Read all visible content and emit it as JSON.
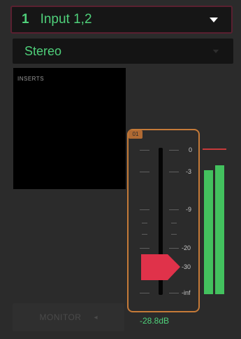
{
  "input": {
    "number": "1",
    "label": "Input 1,2"
  },
  "mode": {
    "label": "Stereo"
  },
  "inserts": {
    "label": "INSERTS"
  },
  "fader": {
    "channel_badge": "01",
    "scale_labels": [
      "0",
      "-3",
      "-9",
      "-20",
      "-30",
      "-inf"
    ],
    "level_db": -28.8
  },
  "meters": {
    "left_level": 0.84,
    "right_level": 0.87
  },
  "monitor": {
    "label": "MONITOR",
    "icon": "speaker-icon"
  },
  "gain_readout": "-28.8dB",
  "colors": {
    "accent_green": "#4fd07a",
    "meter_green": "#43c15e",
    "fader_frame": "#c57a38",
    "fader_cap": "#e0324a",
    "peak_red": "#c73a3a"
  }
}
